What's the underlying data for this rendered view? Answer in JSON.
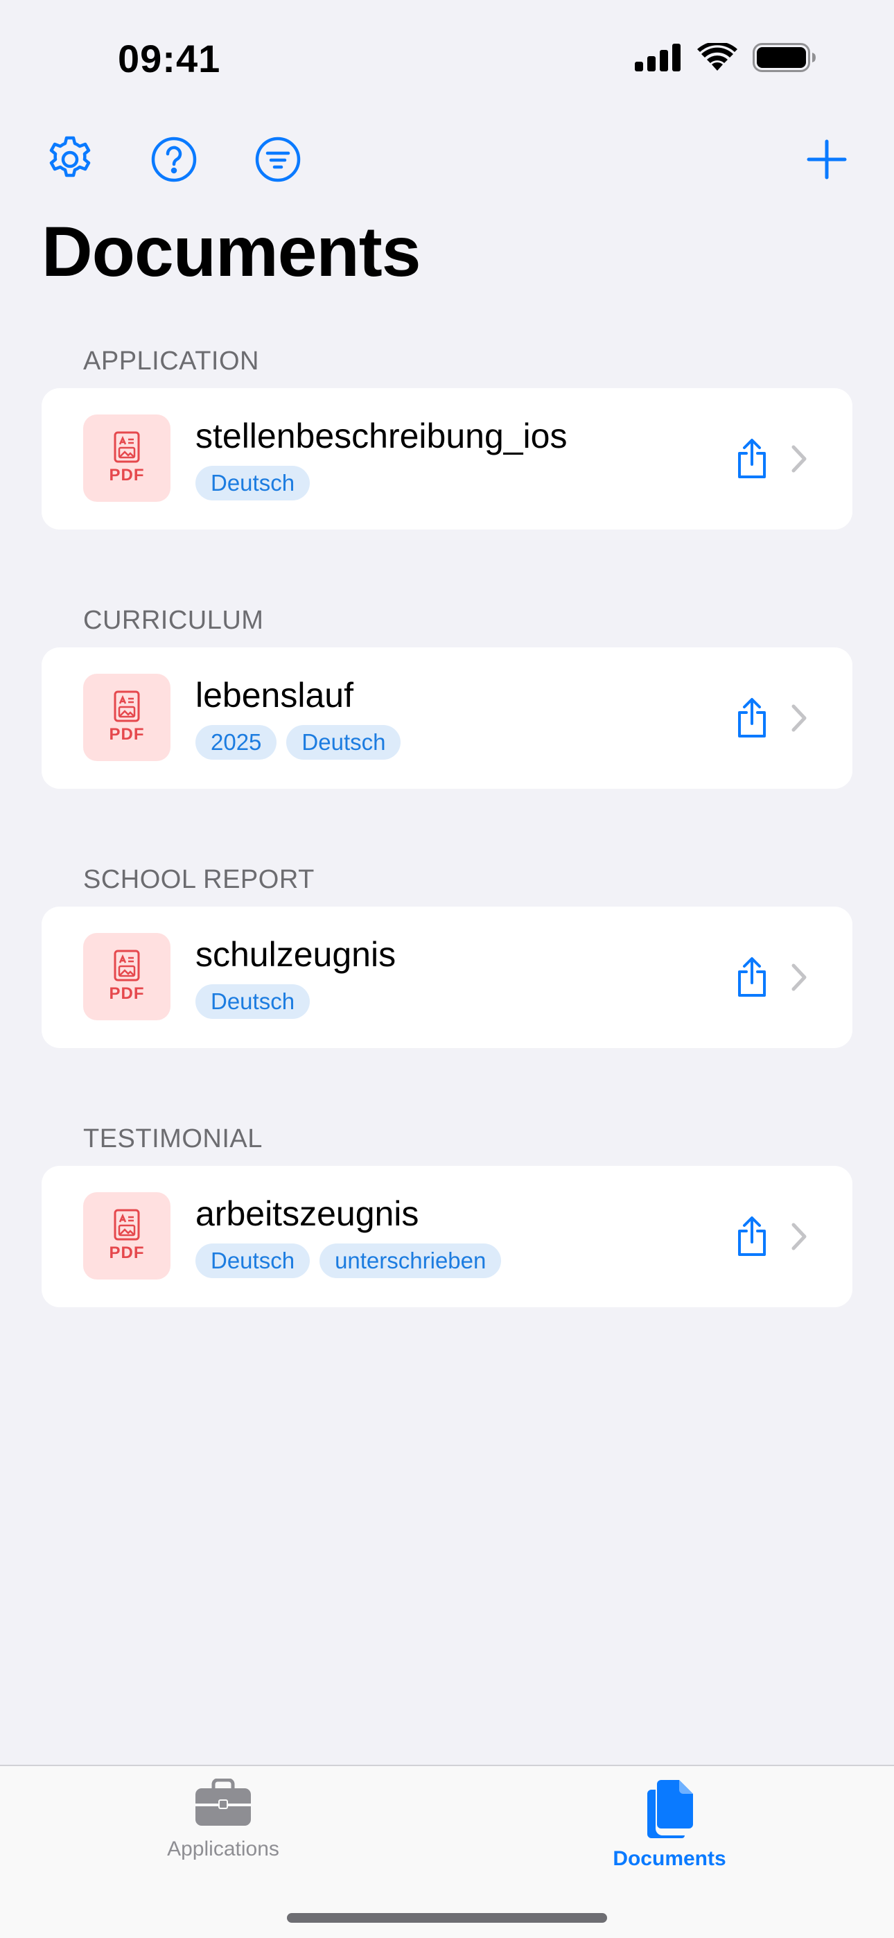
{
  "status_bar": {
    "time": "09:41",
    "icons": [
      "cellular-signal-icon",
      "wifi-icon",
      "battery-icon"
    ]
  },
  "toolbar": {
    "icons": [
      "gear-icon",
      "help-circle-icon",
      "filter-icon",
      "plus-icon"
    ]
  },
  "page": {
    "title": "Documents"
  },
  "sections": [
    {
      "header": "APPLICATION",
      "document": {
        "name": "stellenbeschreibung_ios",
        "thumb_label": "PDF",
        "tags": [
          "Deutsch"
        ]
      }
    },
    {
      "header": "CURRICULUM",
      "document": {
        "name": "lebenslauf",
        "thumb_label": "PDF",
        "tags": [
          "2025",
          "Deutsch"
        ]
      }
    },
    {
      "header": "SCHOOL REPORT",
      "document": {
        "name": "schulzeugnis",
        "thumb_label": "PDF",
        "tags": [
          "Deutsch"
        ]
      }
    },
    {
      "header": "TESTIMONIAL",
      "document": {
        "name": "arbeitszeugnis",
        "thumb_label": "PDF",
        "tags": [
          "Deutsch",
          "unterschrieben"
        ]
      }
    }
  ],
  "tab_bar": {
    "tabs": [
      {
        "label": "Applications",
        "icon": "briefcase-icon",
        "selected": false
      },
      {
        "label": "Documents",
        "icon": "documents-icon",
        "selected": true
      }
    ]
  },
  "colors": {
    "accent": "#0A7AFF",
    "background": "#F2F2F7",
    "card": "#FFFFFF",
    "tag_bg": "#DDEBFA",
    "tag_text": "#1C7CE0",
    "pdf_bg": "#FFE0E0",
    "pdf_red": "#E5484D",
    "section_header": "#6C6C70"
  }
}
